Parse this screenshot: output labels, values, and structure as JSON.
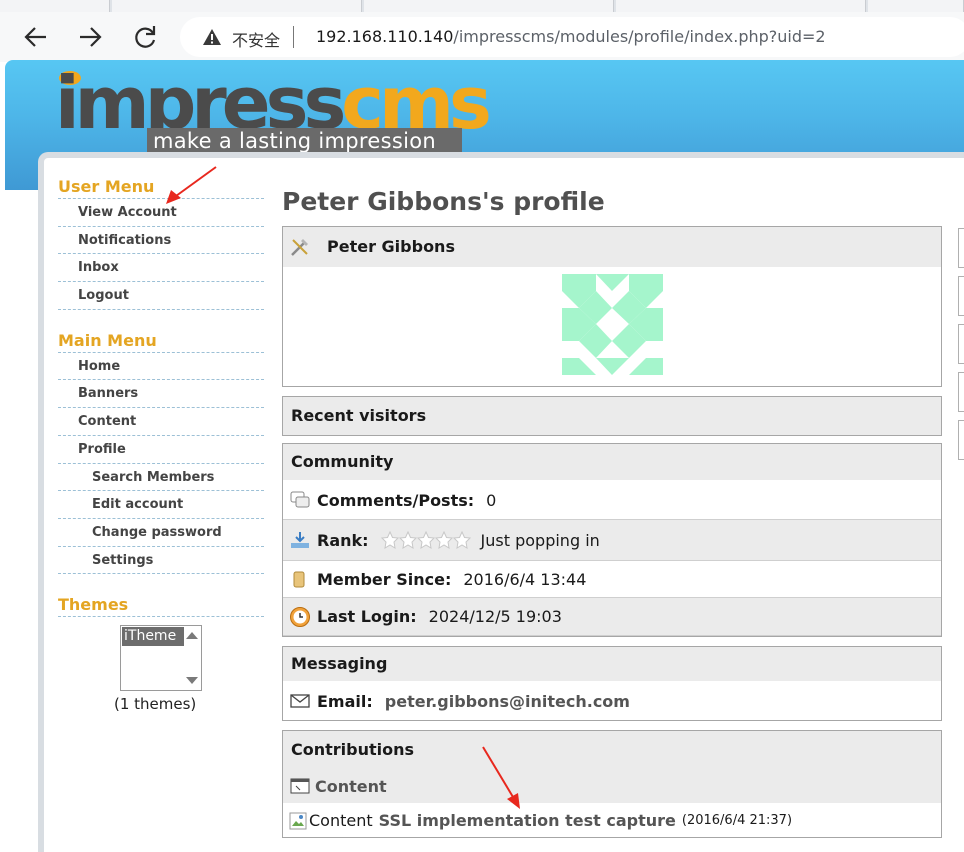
{
  "browser": {
    "insecure_label": "不安全",
    "url_host": "192.168.110.140",
    "url_path": "/impresscms/modules/profile/index.php?uid=2"
  },
  "logo": {
    "word_main": "impress",
    "word_accent": "cms",
    "tagline": "make a lasting impression"
  },
  "user_menu": {
    "title": "User Menu",
    "items": [
      "View Account",
      "Notifications",
      "Inbox",
      "Logout"
    ]
  },
  "main_menu": {
    "title": "Main Menu",
    "items": [
      "Home",
      "Banners",
      "Content",
      "Profile"
    ],
    "subitems": [
      "Search Members",
      "Edit account",
      "Change password",
      "Settings"
    ]
  },
  "themes": {
    "title": "Themes",
    "selected": "iTheme",
    "count_label": "(1 themes)"
  },
  "profile": {
    "page_title": "Peter Gibbons's profile",
    "user_name": "Peter Gibbons"
  },
  "recent_visitors": {
    "title": "Recent visitors"
  },
  "community": {
    "title": "Community",
    "comments_label": "Comments/Posts:",
    "comments_value": "0",
    "rank_label": "Rank:",
    "rank_value": "Just popping in",
    "member_since_label": "Member Since:",
    "member_since_value": "2016/6/4 13:44",
    "last_login_label": "Last Login:",
    "last_login_value": "2024/12/5 19:03"
  },
  "messaging": {
    "title": "Messaging",
    "email_label": "Email:",
    "email_value": "peter.gibbons@initech.com"
  },
  "contributions": {
    "title": "Contributions",
    "section_label": "Content",
    "item_alt": "Content",
    "item_title": "SSL implementation test capture",
    "item_date": "(2016/6/4 21:37)"
  },
  "colors": {
    "accent": "#e4a522",
    "banner": "#4db5e8",
    "avatar": "#a5f5cc"
  }
}
